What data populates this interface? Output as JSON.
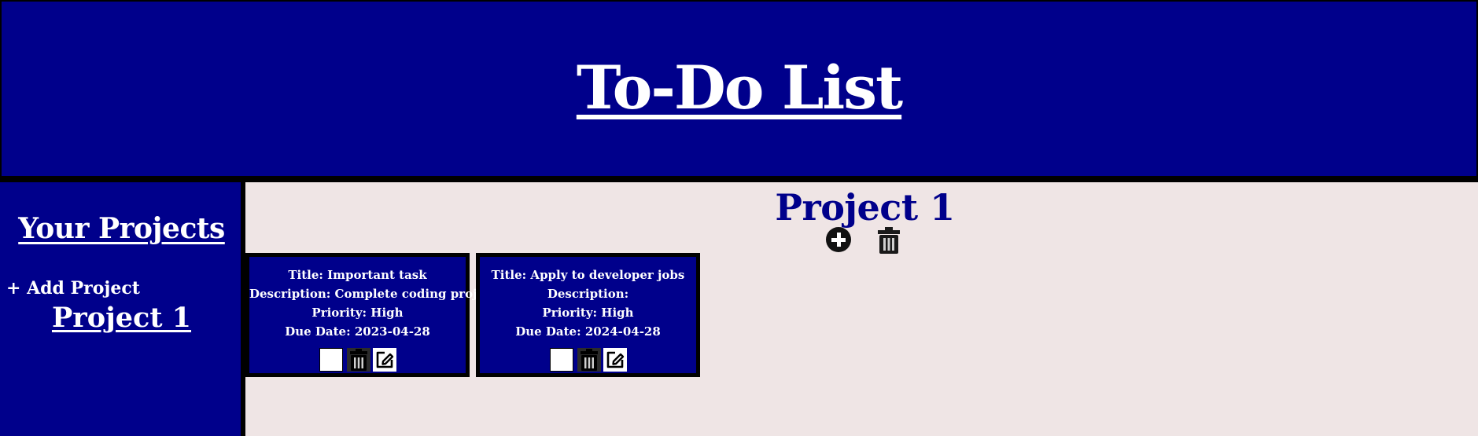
{
  "header": {
    "title": "To-Do List"
  },
  "sidebar": {
    "heading": "Your Projects",
    "add_project_label": "+ Add Project",
    "projects": [
      {
        "name": "Project 1"
      }
    ]
  },
  "main": {
    "project_title": "Project 1",
    "tasks": [
      {
        "title": "Title: Important task",
        "description": "Description: Complete coding project",
        "priority": "Priority: High",
        "due_date": "Due Date: 2023-04-28"
      },
      {
        "title": "Title: Apply to developer jobs",
        "description": "Description:",
        "priority": "Priority: High",
        "due_date": "Due Date: 2024-04-28"
      }
    ]
  },
  "icons": {
    "add_task": "plus-circle-icon",
    "delete_project": "trash-icon",
    "task_delete": "trash-icon",
    "task_edit": "edit-icon"
  },
  "colors": {
    "primary": "#00008b",
    "content_bg": "#efe5e5",
    "border": "#000000",
    "text_light": "#ffffff"
  }
}
